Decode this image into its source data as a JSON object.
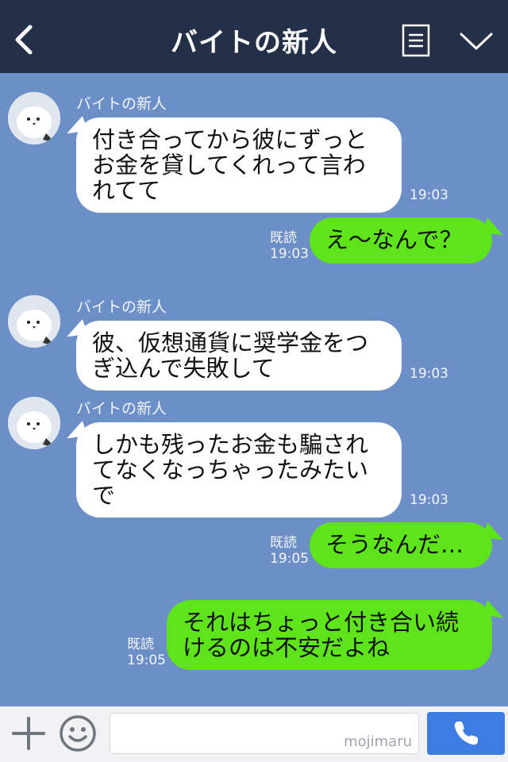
{
  "header": {
    "title": "バイトの新人"
  },
  "messages": [
    {
      "sender": "バイトの新人",
      "text": "付き合ってから彼にずっとお金を貸してくれって言われてて",
      "time": "19:03"
    },
    {
      "read": "既読",
      "text": "え〜なんで？",
      "time": "19:03"
    },
    {
      "sender": "バイトの新人",
      "text": "彼、仮想通貨に奨学金をつぎ込んで失敗して",
      "time": "19:03"
    },
    {
      "sender": "バイトの新人",
      "text": "しかも残ったお金も騙されてなくなっちゃったみたいで",
      "time": "19:03"
    },
    {
      "read": "既読",
      "text": "そうなんだ…",
      "time": "19:05"
    },
    {
      "read": "既読",
      "text": "それはちょっと付き合い続けるのは不安だよね",
      "time": "19:05"
    }
  ],
  "input": {
    "value": "",
    "watermark": "mojimaru"
  },
  "icons": {
    "back": "chevron-left-icon",
    "menu": "notes-icon",
    "collapse": "chevron-down-icon",
    "add": "plus-icon",
    "sticker": "smiley-icon",
    "call": "phone-icon"
  },
  "colors": {
    "header": "#233047",
    "chat_background": "#6b8fc6",
    "outgoing_bubble": "#5fe31a",
    "incoming_bubble": "#ffffff",
    "call_button": "#3d7ce0"
  }
}
